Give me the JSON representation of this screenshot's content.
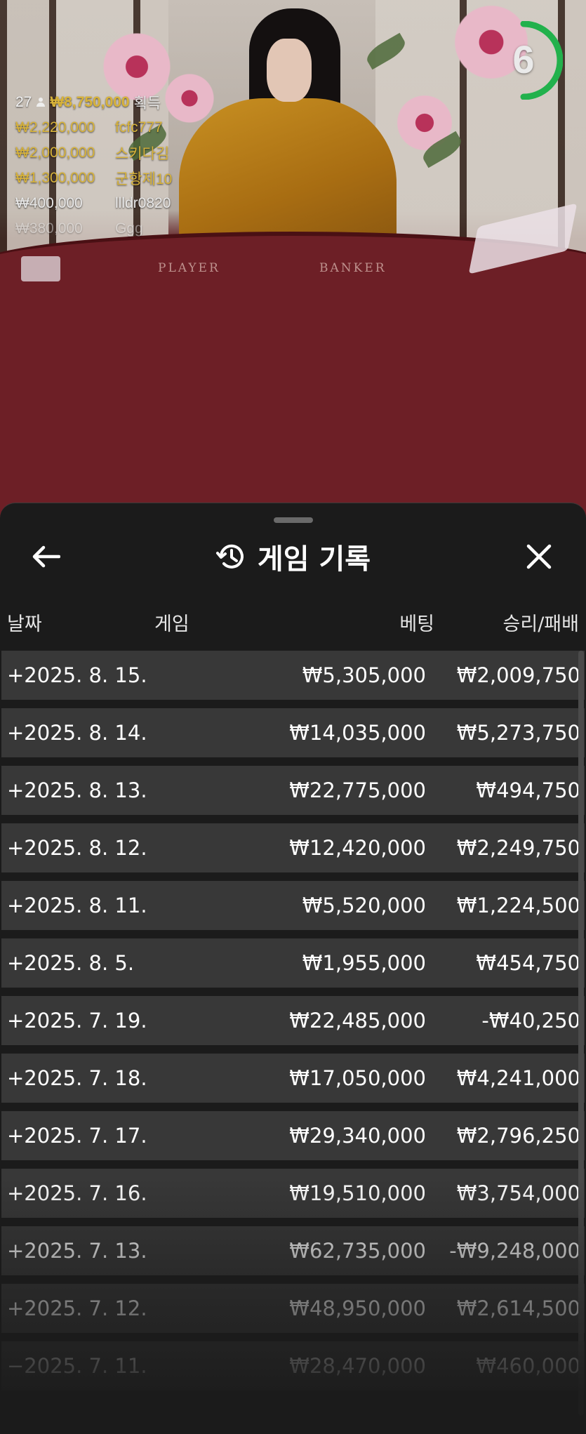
{
  "video": {
    "felt_player": "PLAYER",
    "felt_banker": "BANKER",
    "countdown": "6",
    "winners": {
      "count": "27",
      "total": "₩8,750,000",
      "total_label": "획득",
      "list": [
        {
          "amount": "₩2,220,000",
          "name": "fcfc777"
        },
        {
          "amount": "₩2,000,000",
          "name": "스키다김"
        },
        {
          "amount": "₩1,300,000",
          "name": "군항제10"
        },
        {
          "amount": "₩400,000",
          "name": "llldr0820"
        },
        {
          "amount": "₩380,000",
          "name": "Ggg"
        }
      ]
    }
  },
  "sheet": {
    "title": "게임 기록",
    "columns": {
      "date": "날짜",
      "game": "게임",
      "bet": "베팅",
      "result": "승리/패배"
    },
    "rows": [
      {
        "date": "+2025. 8. 15.",
        "bet": "₩5,305,000",
        "result": "₩2,009,750"
      },
      {
        "date": "+2025. 8. 14.",
        "bet": "₩14,035,000",
        "result": "₩5,273,750"
      },
      {
        "date": "+2025. 8. 13.",
        "bet": "₩22,775,000",
        "result": "₩494,750"
      },
      {
        "date": "+2025. 8. 12.",
        "bet": "₩12,420,000",
        "result": "₩2,249,750"
      },
      {
        "date": "+2025. 8. 11.",
        "bet": "₩5,520,000",
        "result": "₩1,224,500"
      },
      {
        "date": "+2025. 8. 5.",
        "bet": "₩1,955,000",
        "result": "₩454,750"
      },
      {
        "date": "+2025. 7. 19.",
        "bet": "₩22,485,000",
        "result": "-₩40,250"
      },
      {
        "date": "+2025. 7. 18.",
        "bet": "₩17,050,000",
        "result": "₩4,241,000"
      },
      {
        "date": "+2025. 7. 17.",
        "bet": "₩29,340,000",
        "result": "₩2,796,250"
      },
      {
        "date": "+2025. 7. 16.",
        "bet": "₩19,510,000",
        "result": "₩3,754,000"
      },
      {
        "date": "+2025. 7. 13.",
        "bet": "₩62,735,000",
        "result": "-₩9,248,000"
      },
      {
        "date": "+2025. 7. 12.",
        "bet": "₩48,950,000",
        "result": "₩2,614,500"
      },
      {
        "date": "−2025. 7. 11.",
        "bet": "₩28,470,000",
        "result": "₩460,000"
      }
    ]
  },
  "icons": {
    "back": "arrow-left-icon",
    "history": "history-clock-icon",
    "close": "close-x-icon"
  },
  "colors": {
    "gold": "#d8b33a",
    "timer_ring": "#22b14c",
    "row_bg": "#383838",
    "sheet_bg": "#1b1b1b"
  }
}
